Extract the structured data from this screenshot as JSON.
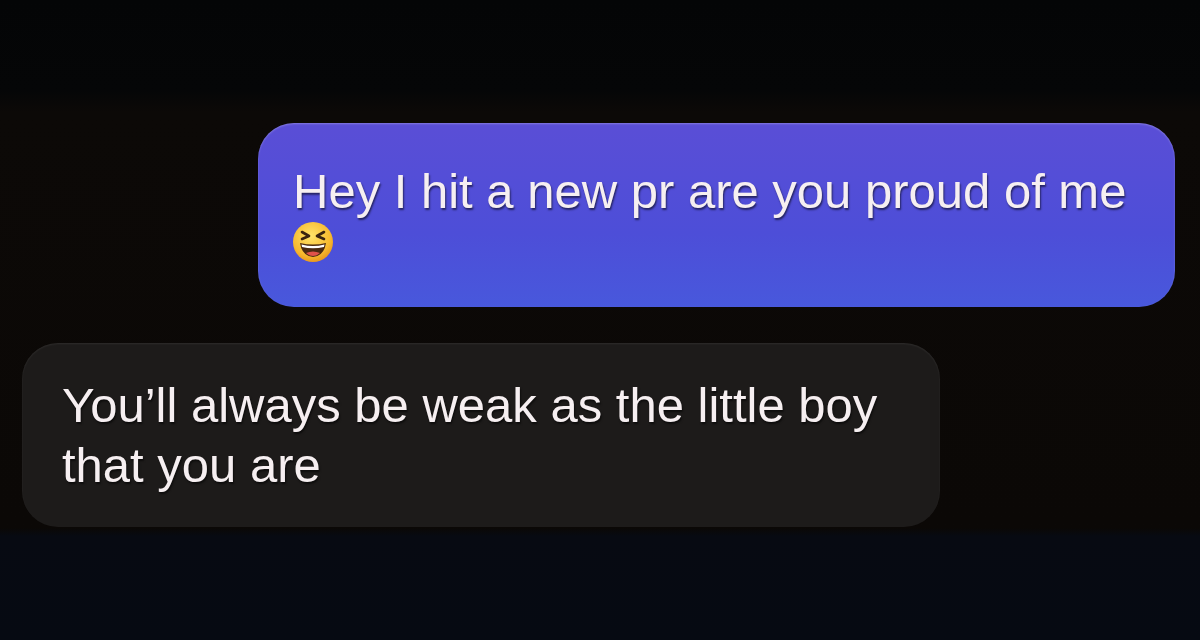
{
  "messages": [
    {
      "kind": "sent",
      "text": "Hey I hit a new pr are you proud of me",
      "emoji": true
    },
    {
      "kind": "received",
      "text": "You’ll always be weak as the little boy that you are",
      "emoji": false
    }
  ]
}
